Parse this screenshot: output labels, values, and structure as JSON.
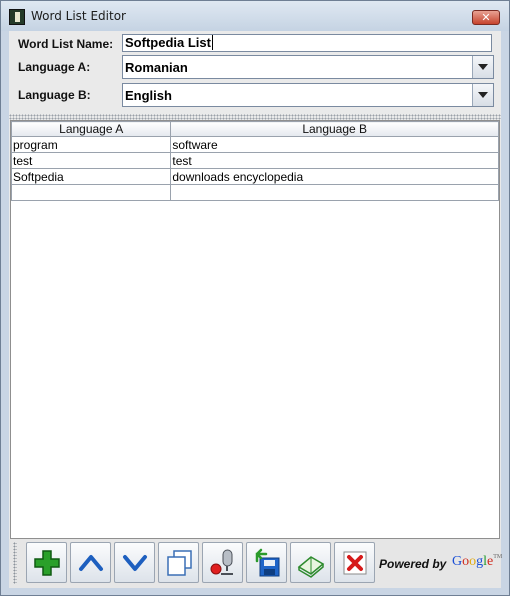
{
  "window": {
    "title": "Word List Editor",
    "close_glyph": "✕"
  },
  "form": {
    "name_label": "Word List Name:",
    "name_value": "Softpedia List",
    "lang_a_label": "Language A:",
    "lang_a_value": "Romanian",
    "lang_b_label": "Language B:",
    "lang_b_value": "English"
  },
  "table": {
    "columns": [
      "Language A",
      "Language B"
    ],
    "rows": [
      [
        "program",
        "software"
      ],
      [
        "test",
        "test"
      ],
      [
        "Softpedia",
        "downloads encyclopedia"
      ],
      [
        "",
        ""
      ]
    ]
  },
  "toolbar": {
    "icons": [
      "add-icon",
      "move-up-icon",
      "move-down-icon",
      "copy-icon",
      "record-icon",
      "save-icon",
      "open-book-icon",
      "delete-icon"
    ],
    "powered_by": "Powered by",
    "google_letters": [
      "G",
      "o",
      "o",
      "g",
      "l",
      "e"
    ],
    "google_tm": "TM"
  },
  "colors": {
    "add": "#2aa02a",
    "arrow": "#1d5fbf",
    "delete": "#d61a1a",
    "save": "#1e64c8"
  }
}
